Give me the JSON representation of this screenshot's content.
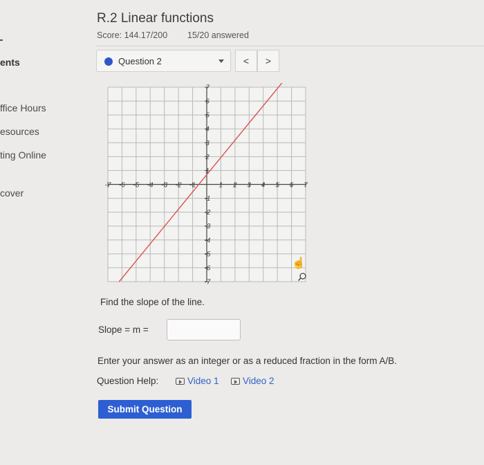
{
  "sidebar": {
    "items": [
      {
        "label": "ents"
      },
      {
        "label": "ffice Hours"
      },
      {
        "label": "esources"
      },
      {
        "label": "ting Online"
      },
      {
        "label": "cover"
      }
    ]
  },
  "header": {
    "title": "R.2 Linear functions",
    "score": "Score: 144.17/200",
    "answered": "15/20 answered"
  },
  "question_select": {
    "label": "Question 2"
  },
  "nav": {
    "prev": "<",
    "next": ">"
  },
  "chart_data": {
    "type": "line",
    "title": "",
    "xlabel": "",
    "ylabel": "",
    "xlim": [
      -7,
      7
    ],
    "ylim": [
      -7,
      7
    ],
    "grid": true,
    "x_ticks": [
      -7,
      -6,
      -5,
      -4,
      -3,
      -2,
      -1,
      1,
      2,
      3,
      4,
      5,
      6,
      7
    ],
    "y_ticks": [
      7,
      6,
      5,
      4,
      3,
      2,
      1,
      -1,
      -2,
      -3,
      -4,
      -5,
      -6,
      -7
    ],
    "series": [
      {
        "color": "#d9534f",
        "points": [
          [
            -6.2,
            -7
          ],
          [
            5.4,
            7.4
          ]
        ]
      }
    ]
  },
  "prompt": "Find the slope of the line.",
  "slope": {
    "label": "Slope = m =",
    "value": ""
  },
  "instruction": "Enter your answer as an integer or as a reduced fraction in the form A/B.",
  "help": {
    "label": "Question Help:",
    "video1": "Video 1",
    "video2": "Video 2"
  },
  "submit_label": "Submit Question"
}
